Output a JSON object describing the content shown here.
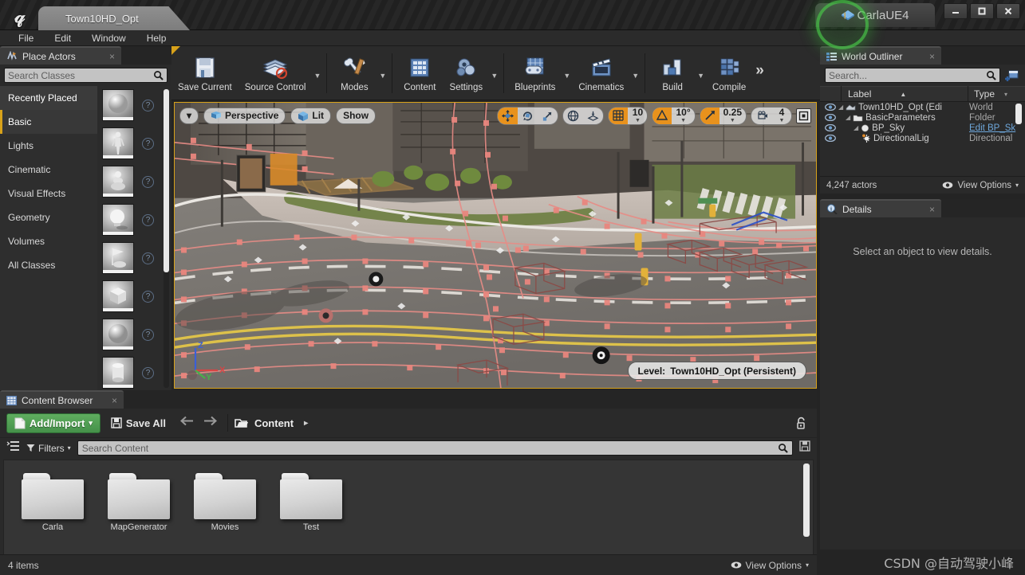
{
  "titlebar": {
    "logo": "unreal-logo",
    "project_tab": "Town10HD_Opt",
    "app_tab": "CarlaUE4",
    "minimize": "–",
    "maximize": "▢",
    "close": "✕"
  },
  "menubar": {
    "items": [
      {
        "label": "File"
      },
      {
        "label": "Edit"
      },
      {
        "label": "Window"
      },
      {
        "label": "Help"
      }
    ]
  },
  "toolbar": {
    "items": [
      {
        "label": "Save Current",
        "icon": "floppy-disk-icon",
        "caret": false
      },
      {
        "label": "Source Control",
        "icon": "source-control-icon",
        "caret": true
      },
      {
        "label": "Modes",
        "icon": "wrench-pencil-icon",
        "caret": true
      },
      {
        "label": "Content",
        "icon": "content-grid-icon",
        "caret": false
      },
      {
        "label": "Settings",
        "icon": "gear-icon",
        "caret": true
      },
      {
        "label": "Blueprints",
        "icon": "blueprint-gamepad-icon",
        "caret": true
      },
      {
        "label": "Cinematics",
        "icon": "clapperboard-icon",
        "caret": true
      },
      {
        "label": "Build",
        "icon": "build-blocks-icon",
        "caret": true
      },
      {
        "label": "Compile",
        "icon": "compile-cubes-icon",
        "caret": false
      }
    ],
    "overflow": "»"
  },
  "place_actors": {
    "tab_title": "Place Actors",
    "tab_icon": "place-actors-icon",
    "close": "×",
    "search_placeholder": "Search Classes",
    "search_icon": "search-icon",
    "categories": [
      {
        "label": "Recently Placed",
        "state": "hover"
      },
      {
        "label": "Basic",
        "state": "selected"
      },
      {
        "label": "Lights",
        "state": "normal"
      },
      {
        "label": "Cinematic",
        "state": "normal"
      },
      {
        "label": "Visual Effects",
        "state": "normal"
      },
      {
        "label": "Geometry",
        "state": "normal"
      },
      {
        "label": "Volumes",
        "state": "normal"
      },
      {
        "label": "All Classes",
        "state": "normal"
      }
    ],
    "items": [
      {
        "thumb": "sphere-thumbnail",
        "help": "?"
      },
      {
        "thumb": "character-thumbnail",
        "help": "?"
      },
      {
        "thumb": "pawn-thumbnail",
        "help": "?"
      },
      {
        "thumb": "point-light-thumbnail",
        "help": "?"
      },
      {
        "thumb": "player-start-thumbnail",
        "help": "?"
      },
      {
        "thumb": "cube-thumbnail",
        "help": "?"
      },
      {
        "thumb": "sphere-thumbnail-2",
        "help": "?"
      },
      {
        "thumb": "cylinder-thumbnail",
        "help": "?"
      }
    ]
  },
  "viewport": {
    "camera_dropdown": "▾",
    "perspective_label": "Perspective",
    "perspective_icon": "camera-icon",
    "lit_label": "Lit",
    "lit_icon": "lit-cube-icon",
    "show_label": "Show",
    "gizmos": [
      {
        "name": "translate-gizmo-icon",
        "active": true
      },
      {
        "name": "rotate-gizmo-icon",
        "active": false
      },
      {
        "name": "scale-gizmo-icon",
        "active": false
      }
    ],
    "coord_icons": [
      {
        "name": "world-coordinate-icon",
        "active": false
      },
      {
        "name": "surface-snap-icon",
        "active": false
      }
    ],
    "grid_snap": {
      "icon": "grid-snap-icon",
      "active": true,
      "value": "10"
    },
    "rotation_snap": {
      "icon": "angle-snap-icon",
      "active": true,
      "value": "10°"
    },
    "scale_snap": {
      "icon": "scale-snap-icon",
      "active": true,
      "value": "0.25"
    },
    "camera_speed": {
      "icon": "camera-speed-icon",
      "active": false,
      "value": "4"
    },
    "maximize_icon": "maximize-viewport-icon",
    "level_label": "Level:",
    "level_name": "Town10HD_Opt (Persistent)",
    "axis": {
      "x": "X",
      "y": "Y",
      "z": "Z"
    }
  },
  "world_outliner": {
    "tab_title": "World Outliner",
    "tab_icon": "outliner-icon",
    "close": "×",
    "search_placeholder": "Search...",
    "search_icon": "search-icon",
    "add_icon": "add-column-icon",
    "columns": {
      "label": "Label",
      "type": "Type",
      "sort_asc": "▲",
      "sort_icon": "▾"
    },
    "rows": [
      {
        "label": "Town10HD_Opt (Edi",
        "type": "World",
        "indent": 0,
        "icon": "world-icon",
        "eye": "eye-icon",
        "link": false
      },
      {
        "label": "BasicParameters",
        "type": "Folder",
        "indent": 1,
        "icon": "folder-icon",
        "eye": "eye-icon",
        "link": false
      },
      {
        "label": "BP_Sky",
        "type": "Edit BP_Sk",
        "indent": 2,
        "icon": "sphere-icon",
        "eye": "eye-icon",
        "link": true
      },
      {
        "label": "DirectionalLig",
        "type": "Directional",
        "indent": 3,
        "icon": "light-icon",
        "eye": "eye-icon",
        "link": false
      }
    ],
    "actor_count": "4,247 actors",
    "view_options": "View Options",
    "view_options_icon": "eye-icon",
    "view_options_caret": "▾"
  },
  "details": {
    "tab_title": "Details",
    "tab_icon": "details-icon",
    "close": "×",
    "empty_message": "Select an object to view details."
  },
  "content_browser": {
    "tab_title": "Content Browser",
    "tab_icon": "content-browser-icon",
    "close": "×",
    "add_import_label": "Add/Import",
    "add_import_icon": "new-file-icon",
    "add_import_caret": "▾",
    "save_all_label": "Save All",
    "save_all_icon": "floppy-disk-icon",
    "back_icon": "arrow-left-icon",
    "forward_icon": "arrow-right-icon",
    "breadcrumb_icon": "folder-open-icon",
    "breadcrumb": "Content",
    "breadcrumb_caret": "▸",
    "lock_icon": "unlock-icon",
    "sources_icon": "sources-panel-icon",
    "filters_label": "Filters",
    "filters_icon": "filter-icon",
    "filters_caret": "▾",
    "search_placeholder": "Search Content",
    "search_icon": "search-icon",
    "save_search_icon": "save-search-icon",
    "folders": [
      {
        "name": "Carla",
        "icon": "folder-icon"
      },
      {
        "name": "MapGenerator",
        "icon": "folder-icon"
      },
      {
        "name": "Movies",
        "icon": "folder-icon"
      },
      {
        "name": "Test",
        "icon": "folder-icon"
      }
    ],
    "item_count": "4 items",
    "view_options": "View Options",
    "view_options_icon": "eye-icon",
    "view_options_caret": "▾"
  },
  "watermark": "CSDN @自动驾驶小峰",
  "colors": {
    "accent_orange": "#d8a21a",
    "snap_active": "#e8921d",
    "green_button": "#4e9b52",
    "green_highlight": "#46c846",
    "link_blue": "#6fa8dc",
    "panel_bg": "#2a2a2a"
  }
}
